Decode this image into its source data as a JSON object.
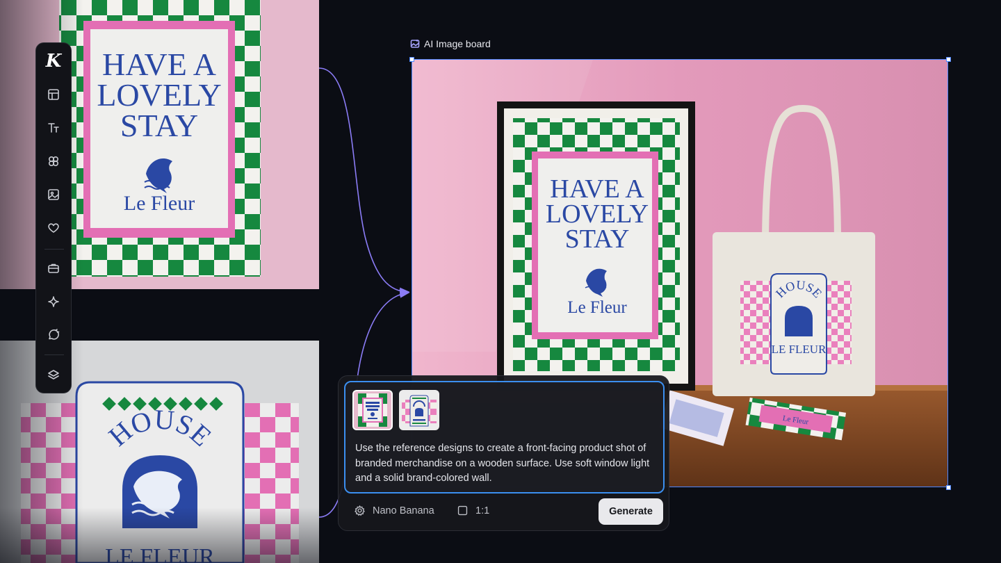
{
  "references": {
    "top": {
      "line1": "HAVE A",
      "line2": "LOVELY",
      "line3": "STAY",
      "brand": "Le Fleur"
    },
    "bottom": {
      "arch_text": "HOUSE",
      "brand": "LE FLEUR"
    }
  },
  "toolbar": {
    "logo": "K",
    "tools": [
      "layout-icon",
      "text-icon",
      "components-icon",
      "image-icon",
      "heart-icon",
      "briefcase-icon",
      "sparkle-icon",
      "comment-icon",
      "layers-icon"
    ]
  },
  "board": {
    "label": "AI Image board",
    "poster": {
      "line1": "HAVE A",
      "line2": "LOVELY",
      "line3": "STAY",
      "brand": "Le Fleur"
    },
    "tote": {
      "arch_text": "HOUSE",
      "brand": "LE FLEUR"
    },
    "card_brand": "Le Fleur"
  },
  "prompt": {
    "text": "Use the reference designs to create a front-facing product shot of branded merchandise on a wooden surface. Use soft window light and a solid brand-colored wall.",
    "model": "Nano Banana",
    "ratio": "1:1",
    "generate_label": "Generate"
  },
  "colors": {
    "accent": "#3b8ff0",
    "connector": "#8b7cf6",
    "brand_blue": "#2a48a4",
    "brand_green": "#16883f",
    "brand_pink": "#e36fb4",
    "wall_pink": "#e19ab8"
  }
}
